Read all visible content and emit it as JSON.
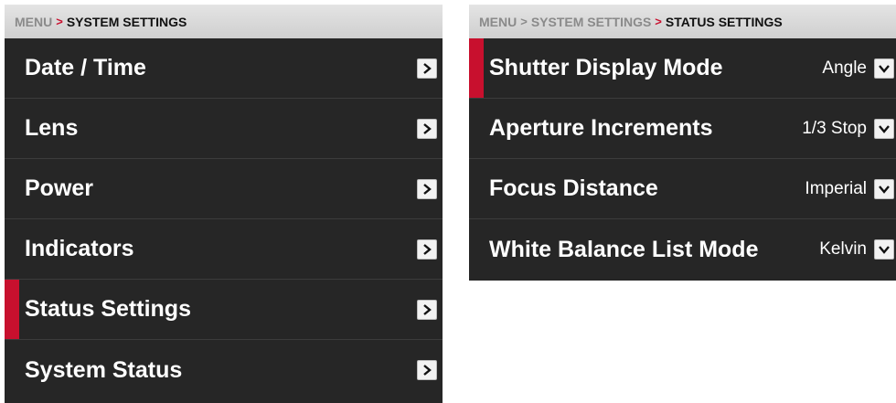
{
  "left": {
    "breadcrumb": {
      "root": "MENU",
      "separator": ">",
      "current": "SYSTEM SETTINGS"
    },
    "items": [
      {
        "label": "Date / Time"
      },
      {
        "label": "Lens"
      },
      {
        "label": "Power"
      },
      {
        "label": "Indicators"
      },
      {
        "label": "Status Settings",
        "selected": true
      },
      {
        "label": "System Status"
      }
    ]
  },
  "right": {
    "breadcrumb": {
      "root": "MENU",
      "separator": ">",
      "middle": "SYSTEM SETTINGS",
      "current": "STATUS SETTINGS"
    },
    "items": [
      {
        "label": "Shutter Display Mode",
        "value": "Angle",
        "selected": true
      },
      {
        "label": "Aperture Increments",
        "value": "1/3 Stop"
      },
      {
        "label": "Focus Distance",
        "value": "Imperial"
      },
      {
        "label": "White Balance List Mode",
        "value": "Kelvin"
      }
    ]
  },
  "colors": {
    "accent": "#c8102e",
    "panel_bg": "#262626",
    "breadcrumb_bg": "#dcdcdc",
    "text": "#ffffff"
  },
  "icons": {
    "navigate": "chevron-right-icon",
    "dropdown": "chevron-down-icon"
  }
}
